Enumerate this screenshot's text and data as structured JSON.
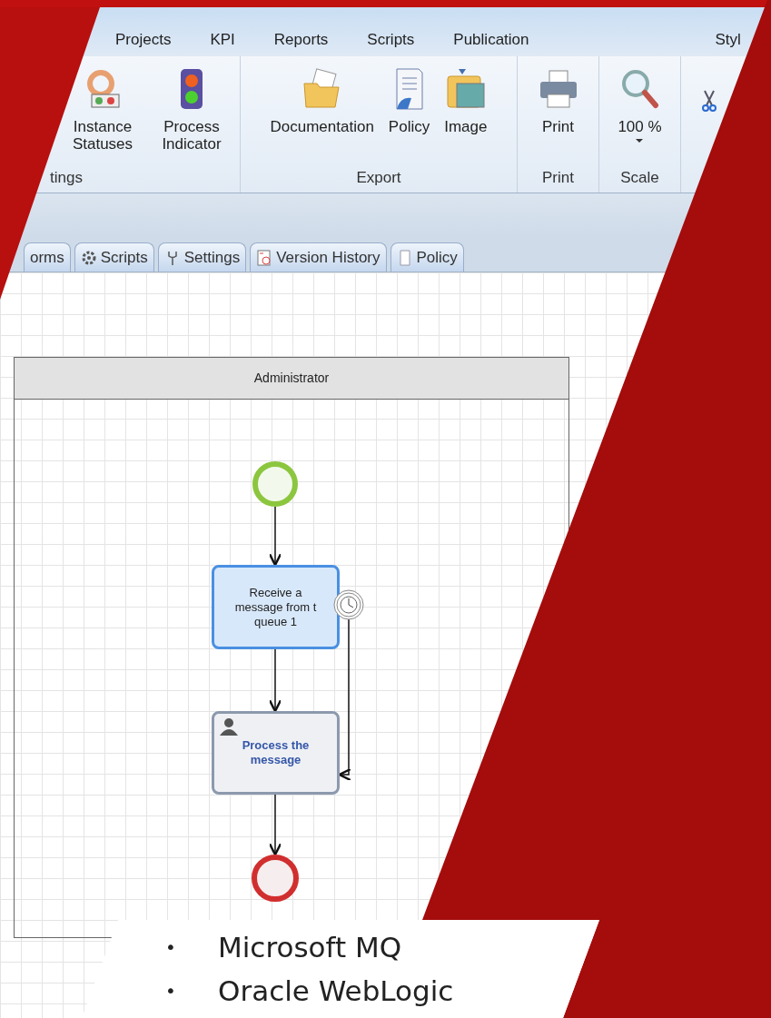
{
  "menu_tabs": [
    {
      "label": "Projects"
    },
    {
      "label": "KPI"
    },
    {
      "label": "Reports"
    },
    {
      "label": "Scripts"
    },
    {
      "label": "Publication"
    },
    {
      "label": "Styl"
    }
  ],
  "ribbon_groups": [
    {
      "label": "tings",
      "buttons": [
        {
          "label": "Instance Statuses",
          "kind": "statuses"
        },
        {
          "label": "Process Indicator",
          "kind": "traffic-light"
        }
      ]
    },
    {
      "label": "Export",
      "buttons": [
        {
          "label": "Documentation",
          "kind": "folder"
        },
        {
          "label": "Policy",
          "kind": "document"
        },
        {
          "label": "Image",
          "kind": "picture"
        }
      ]
    },
    {
      "label": "Print",
      "buttons": [
        {
          "label": "Print",
          "kind": "printer"
        }
      ]
    },
    {
      "label": "Scale",
      "buttons": [
        {
          "label": "100 %",
          "kind": "magnifier",
          "dropdown": true
        }
      ]
    }
  ],
  "doc_tabs": [
    {
      "label": "orms",
      "kind": "none"
    },
    {
      "label": "Scripts",
      "kind": "gear"
    },
    {
      "label": "Settings",
      "kind": "wrench"
    },
    {
      "label": "Version History",
      "kind": "history"
    },
    {
      "label": "Policy",
      "kind": "page"
    }
  ],
  "diagram": {
    "pool": "Administrator",
    "tasks": [
      {
        "label": "Receive a\nmessage from t\nqueue 1",
        "kind": "message"
      },
      {
        "label": "Process the\nmessage",
        "kind": "user"
      }
    ]
  },
  "bullets": [
    {
      "marker": "•",
      "text": "Microsoft MQ"
    },
    {
      "marker": "•",
      "text": "Oracle WebLogic"
    }
  ]
}
